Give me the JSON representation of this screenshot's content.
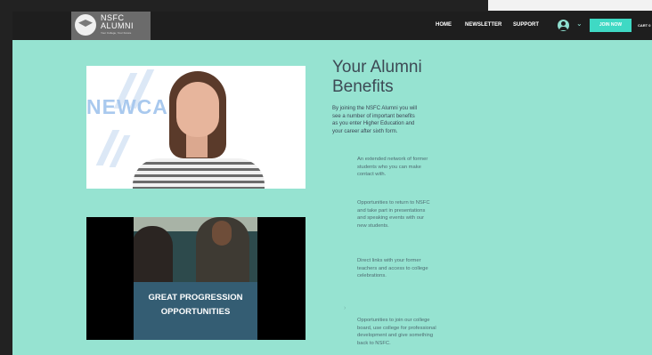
{
  "logo": {
    "title": "NSFC\nALUMNI",
    "tagline": "Your College, Your Future",
    "icon": "graduation-cap-icon"
  },
  "nav": {
    "items": [
      "HOME",
      "NEWSLETTER",
      "SUPPORT"
    ],
    "account_icon": "user-avatar-icon",
    "chevron_icon": "chevron-down-icon",
    "join_label": "JOIN NOW",
    "cart_label": "CART 0"
  },
  "video1": {
    "watermark": "NEWCAS"
  },
  "video2": {
    "caption": "GREAT PROGRESSION\nOPPORTUNITIES"
  },
  "content": {
    "heading": "Your Alumni\nBenefits",
    "intro": "By joining the NSFC Alumni you will\nsee a number of important benefits\nas you enter Higher Education and\nyour career after sixth form.",
    "benefits": [
      "An extended network of former\nstudents who you can make\ncontact with.",
      "Opportunities to return to NSFC\nand take part in presentations\nand speaking events with our\nnew students.",
      "Direct links with your former\nteachers and access to college\ncelebrations.",
      "Opportunities to join our college\nboard, use college for professional\ndevelopment and give something\nback to NSFC."
    ],
    "marker": "›"
  },
  "colors": {
    "page_background": "#96e3d1",
    "header_background": "#1e1e1e",
    "accent": "#3fd9c4",
    "heading_text": "#3d4a55"
  }
}
